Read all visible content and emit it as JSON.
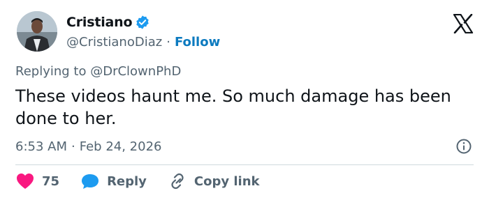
{
  "author": {
    "display_name": "Cristiano",
    "handle": "@CristianoDiaz",
    "verified": true,
    "follow_label": "Follow",
    "separator": "·",
    "avatar_icon": "profile-photo"
  },
  "brand": {
    "logo_icon": "x-logo-icon"
  },
  "tweet": {
    "replying_prefix": "Replying to",
    "replying_to": "@DrClownPhD",
    "text": "These videos haunt me. So much damage has been done to her.",
    "time": "6:53 AM",
    "date": "Feb 24, 2026"
  },
  "actions": {
    "like_count": "75",
    "reply_label": "Reply",
    "copy_label": "Copy link"
  },
  "colors": {
    "text": "#0f1419",
    "secondary": "#536471",
    "link": "#0c7abf",
    "like": "#f91880",
    "reply": "#1d9bf0",
    "verified": "#1d9bf0",
    "divider": "#cfd9de"
  }
}
